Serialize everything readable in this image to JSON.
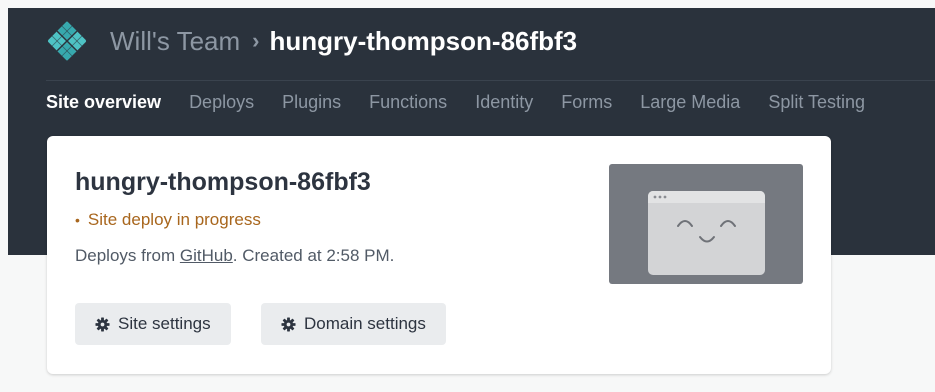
{
  "header": {
    "team_name": "Will's Team",
    "separator": "›",
    "site_name": "hungry-thompson-86fbf3",
    "logo_icon": "netlify-logo-icon"
  },
  "nav": {
    "tabs": [
      {
        "label": "Site overview",
        "active": true
      },
      {
        "label": "Deploys",
        "active": false
      },
      {
        "label": "Plugins",
        "active": false
      },
      {
        "label": "Functions",
        "active": false
      },
      {
        "label": "Identity",
        "active": false
      },
      {
        "label": "Forms",
        "active": false
      },
      {
        "label": "Large Media",
        "active": false
      },
      {
        "label": "Split Testing",
        "active": false
      }
    ]
  },
  "card": {
    "title": "hungry-thompson-86fbf3",
    "status_bullet": "•",
    "status_text": "Site deploy in progress",
    "deploys_from_prefix": "Deploys from ",
    "deploys_from_link": "GitHub",
    "created_text": ". Created at 2:58 PM.",
    "buttons": {
      "site_settings": "Site settings",
      "domain_settings": "Domain settings"
    },
    "preview_icon": "browser-smiley-placeholder-icon"
  },
  "colors": {
    "header_bg": "#2a323c",
    "status": "#a8661d",
    "logo_teal": "#4ec3c5"
  }
}
